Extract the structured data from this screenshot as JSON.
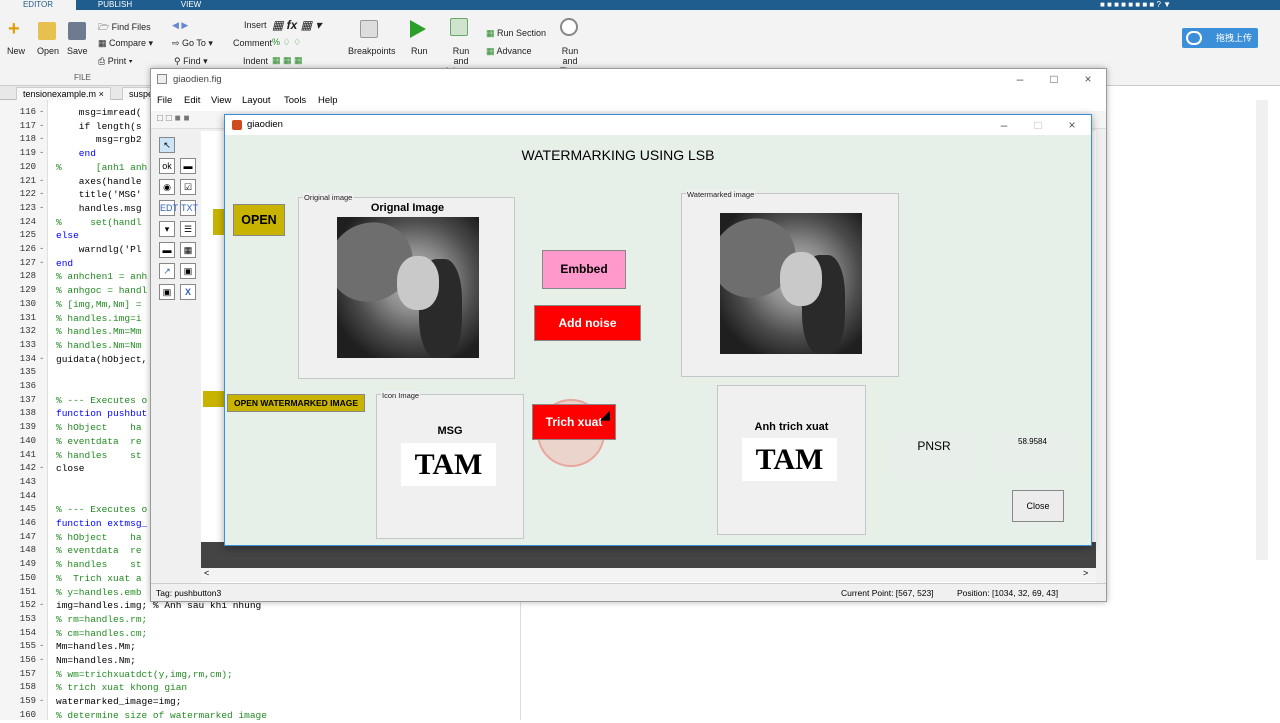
{
  "matlab": {
    "tabs": [
      "EDITOR",
      "PUBLISH",
      "VIEW"
    ],
    "ribbon": {
      "new": "New",
      "open": "Open",
      "save": "Save",
      "find_files": "Find Files",
      "compare": "Compare",
      "print": "Print",
      "go_to": "Go To",
      "find": "Find",
      "insert": "Insert",
      "comment": "Comment",
      "indent": "Indent",
      "breakpoints": "Breakpoints",
      "run": "Run",
      "run_advance": "Run and Advance",
      "run_section": "Run Section",
      "advance": "Advance",
      "run_time": "Run and Time",
      "file_group": "FILE",
      "upload": "拖拽上传"
    },
    "editor_tabs": [
      "tensionexample.m",
      "suspe"
    ],
    "lines": [
      {
        "n": "116",
        "d": "-",
        "t": "    msg=imread(",
        "c": "plain"
      },
      {
        "n": "117",
        "d": "-",
        "t": "    if length(s",
        "c": "plain"
      },
      {
        "n": "118",
        "d": "-",
        "t": "       msg=rgb2",
        "c": "plain"
      },
      {
        "n": "119",
        "d": "-",
        "t": "    end",
        "c": "key"
      },
      {
        "n": "120",
        "d": "",
        "t": "%      [anh1 anh",
        "c": "com"
      },
      {
        "n": "121",
        "d": "-",
        "t": "    axes(handle",
        "c": "plain"
      },
      {
        "n": "122",
        "d": "-",
        "t": "    title('MSG'",
        "c": "plain"
      },
      {
        "n": "123",
        "d": "-",
        "t": "    handles.msg",
        "c": "plain"
      },
      {
        "n": "124",
        "d": "",
        "t": "%     set(handl",
        "c": "com"
      },
      {
        "n": "125",
        "d": "",
        "t": "else",
        "c": "key"
      },
      {
        "n": "126",
        "d": "-",
        "t": "    warndlg('Pl",
        "c": "plain"
      },
      {
        "n": "127",
        "d": "-",
        "t": "end",
        "c": "key"
      },
      {
        "n": "128",
        "d": "",
        "t": "% anhchen1 = anh",
        "c": "com"
      },
      {
        "n": "129",
        "d": "",
        "t": "% anhgoc = handl",
        "c": "com"
      },
      {
        "n": "130",
        "d": "",
        "t": "% [img,Mm,Nm] =",
        "c": "com"
      },
      {
        "n": "131",
        "d": "",
        "t": "% handles.img=i",
        "c": "com"
      },
      {
        "n": "132",
        "d": "",
        "t": "% handles.Mm=Mm",
        "c": "com"
      },
      {
        "n": "133",
        "d": "",
        "t": "% handles.Nm=Nm",
        "c": "com"
      },
      {
        "n": "134",
        "d": "-",
        "t": "guidata(hObject,",
        "c": "plain"
      },
      {
        "n": "135",
        "d": "",
        "t": "",
        "c": "plain"
      },
      {
        "n": "136",
        "d": "",
        "t": "",
        "c": "plain"
      },
      {
        "n": "137",
        "d": "",
        "t": "% --- Executes o",
        "c": "com"
      },
      {
        "n": "138",
        "d": "",
        "t": "function pushbut",
        "c": "key"
      },
      {
        "n": "139",
        "d": "",
        "t": "% hObject    ha",
        "c": "com"
      },
      {
        "n": "140",
        "d": "",
        "t": "% eventdata  re",
        "c": "com"
      },
      {
        "n": "141",
        "d": "",
        "t": "% handles    st",
        "c": "com"
      },
      {
        "n": "142",
        "d": "-",
        "t": "close",
        "c": "plain"
      },
      {
        "n": "143",
        "d": "",
        "t": "",
        "c": "plain"
      },
      {
        "n": "144",
        "d": "",
        "t": "",
        "c": "plain"
      },
      {
        "n": "145",
        "d": "",
        "t": "% --- Executes o",
        "c": "com"
      },
      {
        "n": "146",
        "d": "",
        "t": "function extmsg_",
        "c": "key"
      },
      {
        "n": "147",
        "d": "",
        "t": "% hObject    ha",
        "c": "com"
      },
      {
        "n": "148",
        "d": "",
        "t": "% eventdata  re",
        "c": "com"
      },
      {
        "n": "149",
        "d": "",
        "t": "% handles    st",
        "c": "com"
      },
      {
        "n": "150",
        "d": "",
        "t": "%  Trich xuat a",
        "c": "com"
      },
      {
        "n": "151",
        "d": "",
        "t": "% y=handles.emb",
        "c": "com"
      },
      {
        "n": "152",
        "d": "-",
        "t": "img=handles.img; % Anh sau khi nhung",
        "c": "mix"
      },
      {
        "n": "153",
        "d": "",
        "t": "% rm=handles.rm;",
        "c": "com"
      },
      {
        "n": "154",
        "d": "",
        "t": "% cm=handles.cm;",
        "c": "com"
      },
      {
        "n": "155",
        "d": "-",
        "t": "Mm=handles.Mm;",
        "c": "plain"
      },
      {
        "n": "156",
        "d": "-",
        "t": "Nm=handles.Nm;",
        "c": "plain"
      },
      {
        "n": "157",
        "d": "",
        "t": "% wm=trichxuatdct(y,img,rm,cm);",
        "c": "com"
      },
      {
        "n": "158",
        "d": "",
        "t": "% trich xuat khong gian",
        "c": "com"
      },
      {
        "n": "159",
        "d": "-",
        "t": "watermarked_image=img;",
        "c": "plain"
      },
      {
        "n": "160",
        "d": "",
        "t": "% determine size of watermarked image",
        "c": "com"
      }
    ]
  },
  "guide": {
    "title": "giaodien.fig",
    "menu": [
      "File",
      "Edit",
      "View",
      "Layout",
      "Tools",
      "Help"
    ],
    "status_tag": "Tag: pushbutton3",
    "current_point": "Current Point:  [567, 523]",
    "position": "Position: [1034, 32, 69, 43]"
  },
  "figure": {
    "title": "giaodien",
    "heading": "WATERMARKING USING LSB",
    "open_button": "OPEN",
    "open_wm_button": "OPEN WATERMARKED IMAGE",
    "original_panel": "Original image",
    "original_axes_title": "Orignal Image",
    "watermarked_panel": "Watermarked image",
    "embed_button": "Embbed",
    "noise_button": "Add noise",
    "extract_button": "Trich xuat",
    "icon_panel": "Icon Image",
    "msg_title": "MSG",
    "msg_text": "TAM",
    "extract_title": "Anh trich xuat",
    "extract_text": "TAM",
    "pnsr_label": "PNSR",
    "pnsr_value": "58.9584",
    "close_button": "Close"
  },
  "colors": {
    "embed": "#ff99cc",
    "noise": "#ff0000",
    "open": "#c8b400",
    "figure_bg": "#e6efe8"
  }
}
